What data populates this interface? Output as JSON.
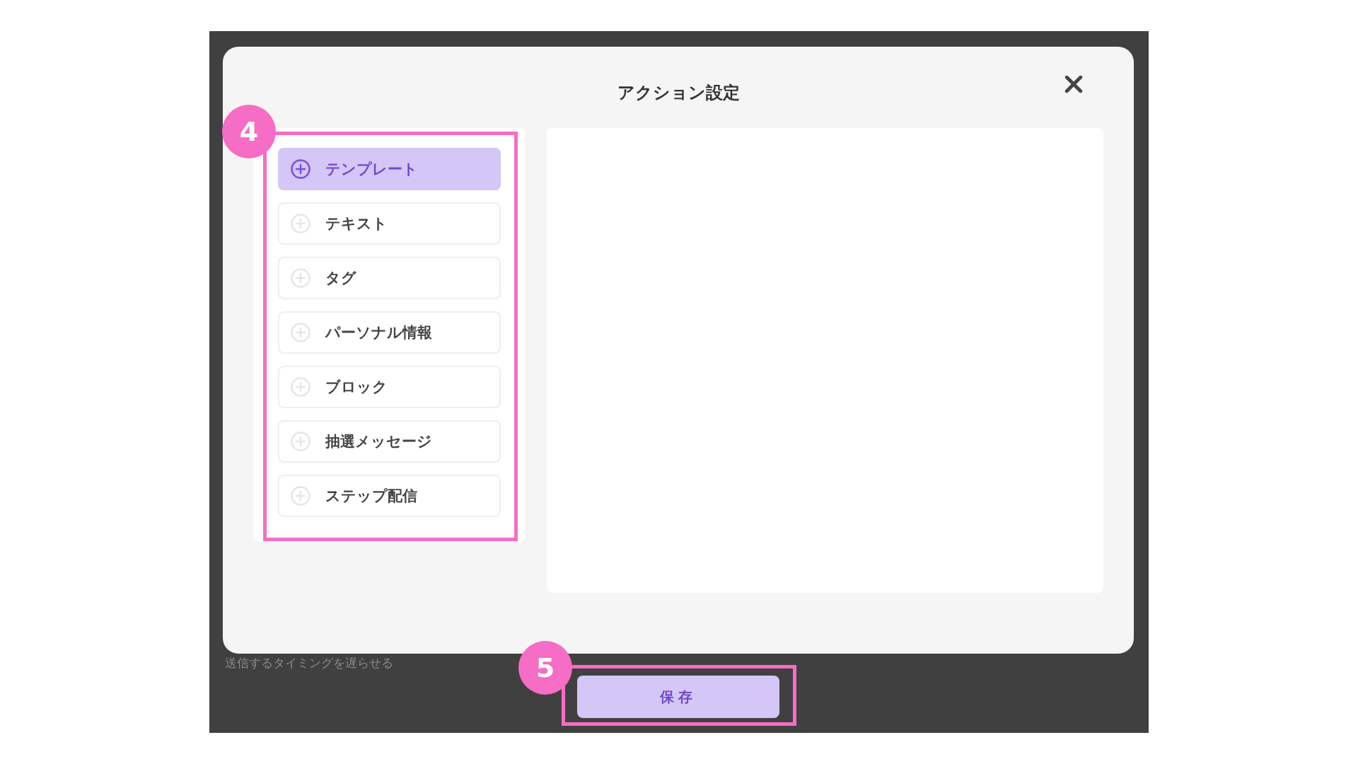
{
  "modal": {
    "title": "アクション設定"
  },
  "action_types": [
    {
      "label": "テンプレート",
      "selected": true
    },
    {
      "label": "テキスト",
      "selected": false
    },
    {
      "label": "タグ",
      "selected": false
    },
    {
      "label": "パーソナル情報",
      "selected": false
    },
    {
      "label": "ブロック",
      "selected": false
    },
    {
      "label": "抽選メッセージ",
      "selected": false
    },
    {
      "label": "ステップ配信",
      "selected": false
    }
  ],
  "save_button": {
    "label": "保存"
  },
  "background_text": "送信するタイミングを遅らせる",
  "annotations": [
    {
      "label": "4"
    },
    {
      "label": "5"
    }
  ]
}
